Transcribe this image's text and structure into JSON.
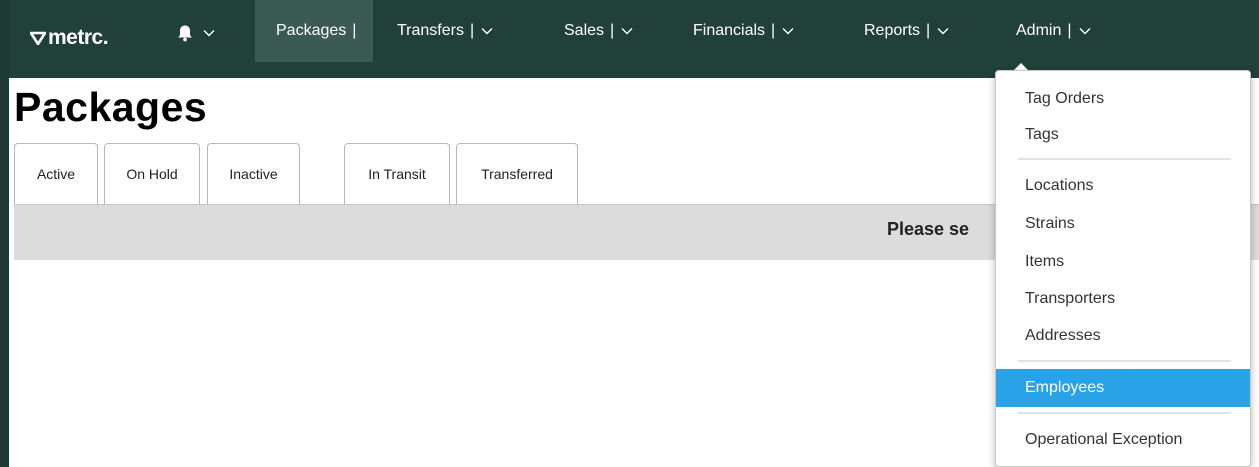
{
  "app": {
    "logo_text": "metrc.",
    "brand_color": "#21403a"
  },
  "nav": {
    "items": [
      {
        "label": "Packages",
        "active": true
      },
      {
        "label": "Transfers"
      },
      {
        "label": "Sales"
      },
      {
        "label": "Financials"
      },
      {
        "label": "Reports"
      },
      {
        "label": "Admin"
      }
    ],
    "separator": "|",
    "bell_icon": "bell-icon",
    "chevron_icon": "chevron-down-icon"
  },
  "page": {
    "title": "Packages"
  },
  "tabs": [
    {
      "label": "Active"
    },
    {
      "label": "On Hold"
    },
    {
      "label": "Inactive"
    },
    {
      "label": "In Transit"
    },
    {
      "label": "Transferred"
    }
  ],
  "banner": {
    "text": "Please se"
  },
  "admin_menu": {
    "items": [
      {
        "label": "Tag Orders"
      },
      {
        "label": "Tags"
      },
      {
        "label": "Locations"
      },
      {
        "label": "Strains"
      },
      {
        "label": "Items"
      },
      {
        "label": "Transporters"
      },
      {
        "label": "Addresses"
      },
      {
        "label": "Employees",
        "highlighted": true
      },
      {
        "label": "Operational Exception"
      }
    ],
    "highlight_color": "#2aa2e8"
  }
}
